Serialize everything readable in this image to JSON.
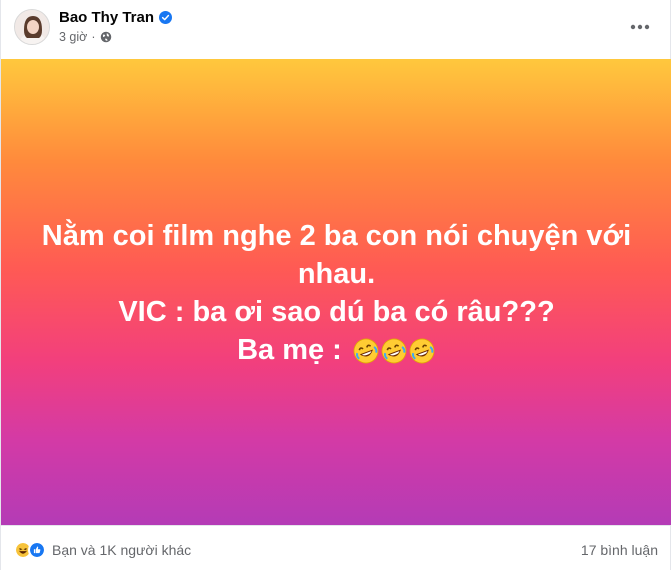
{
  "post": {
    "author": "Bao Thy Tran",
    "time": "3 giờ",
    "visibility_icon": "globe-icon",
    "more_icon": "more-horizontal-icon",
    "content": {
      "line1": "Nằm coi film nghe 2 ba con nói chuyện với",
      "line2": "nhau.",
      "line3": "VIC : ba ơi sao dú ba có râu???",
      "line4": "Ba mẹ :"
    },
    "colors": {
      "gradient_top": "#ffc83d",
      "gradient_mid": "#ff5a54",
      "gradient_bottom": "#b43bb6",
      "verified": "#1877f2"
    }
  },
  "footer": {
    "reactions_text": "Bạn và 1K người khác",
    "comments_text": "17 bình luận"
  }
}
